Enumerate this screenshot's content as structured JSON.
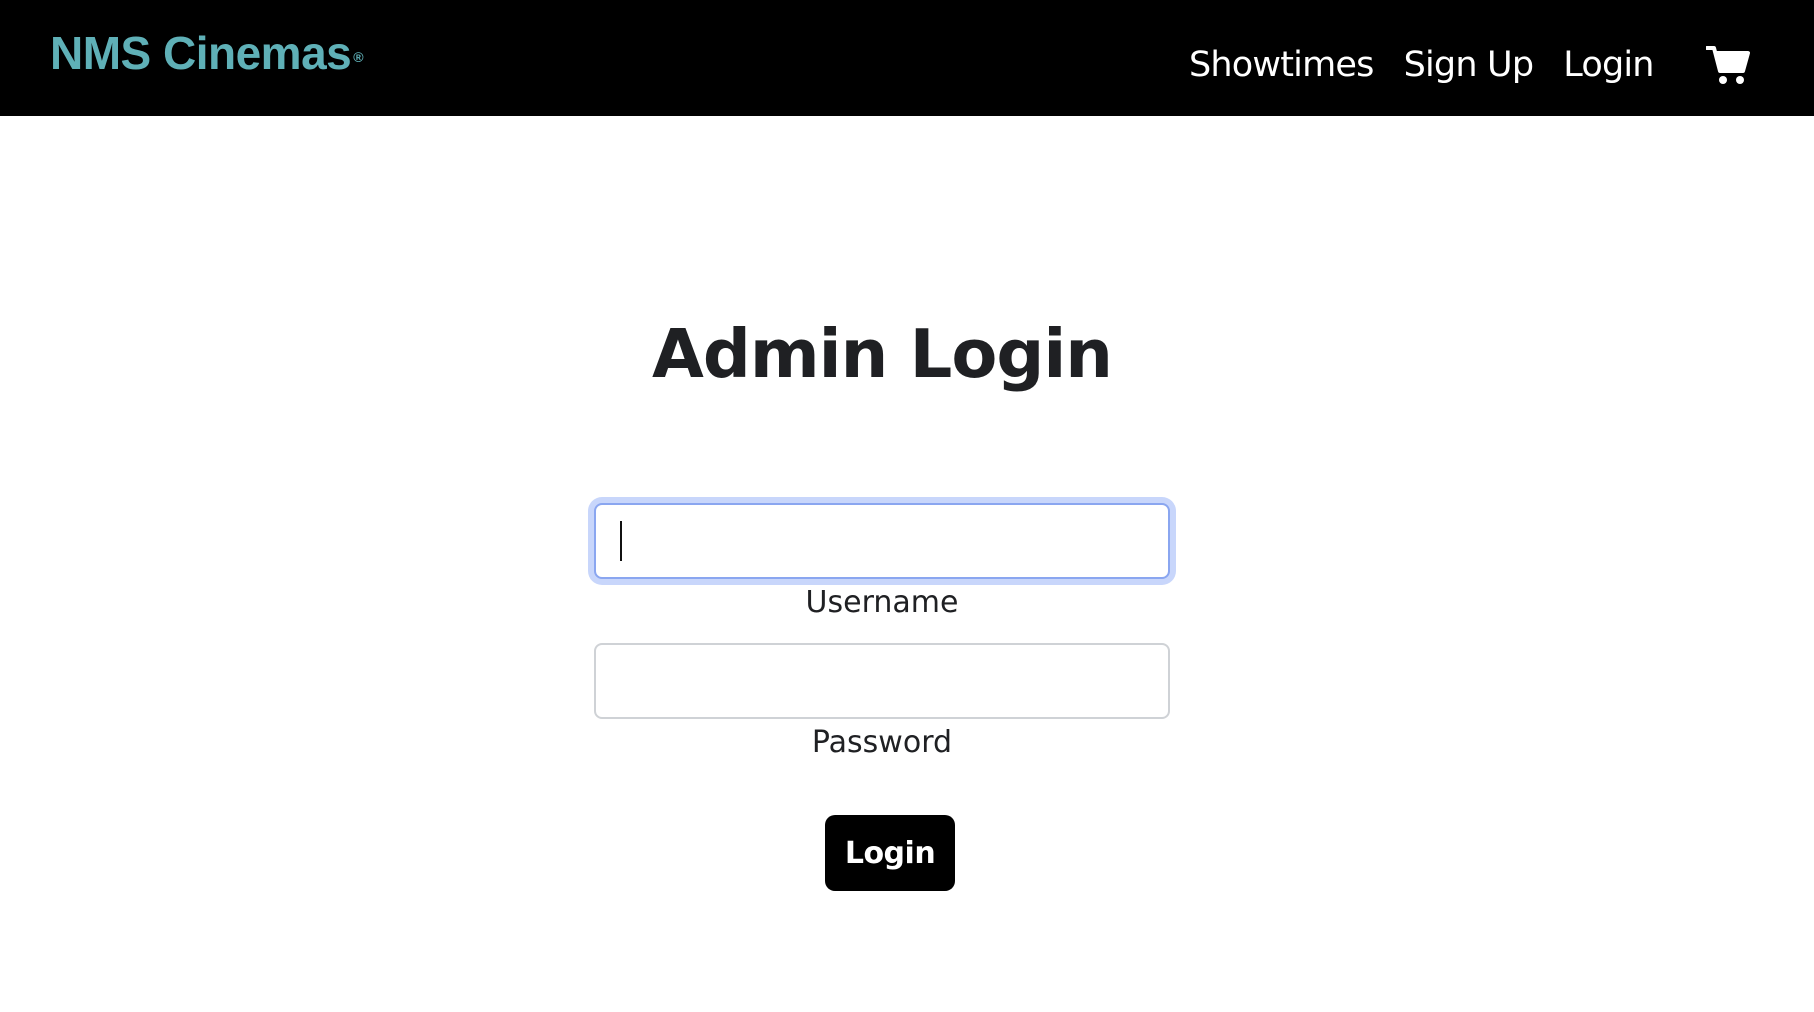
{
  "header": {
    "brand": "NMS Cinemas",
    "brand_mark": "®",
    "nav": [
      {
        "label": "Showtimes"
      },
      {
        "label": "Sign Up"
      },
      {
        "label": "Login"
      }
    ],
    "cart_icon": "shopping-cart-icon"
  },
  "form": {
    "title": "Admin Login",
    "username": {
      "label": "Username",
      "value": "",
      "placeholder": ""
    },
    "password": {
      "label": "Password",
      "value": "",
      "placeholder": ""
    },
    "submit_label": "Login"
  },
  "colors": {
    "navbar_bg": "#000000",
    "brand": "#5fb0b7",
    "focus_ring": "#c8d6fb",
    "button_bg": "#000000"
  }
}
